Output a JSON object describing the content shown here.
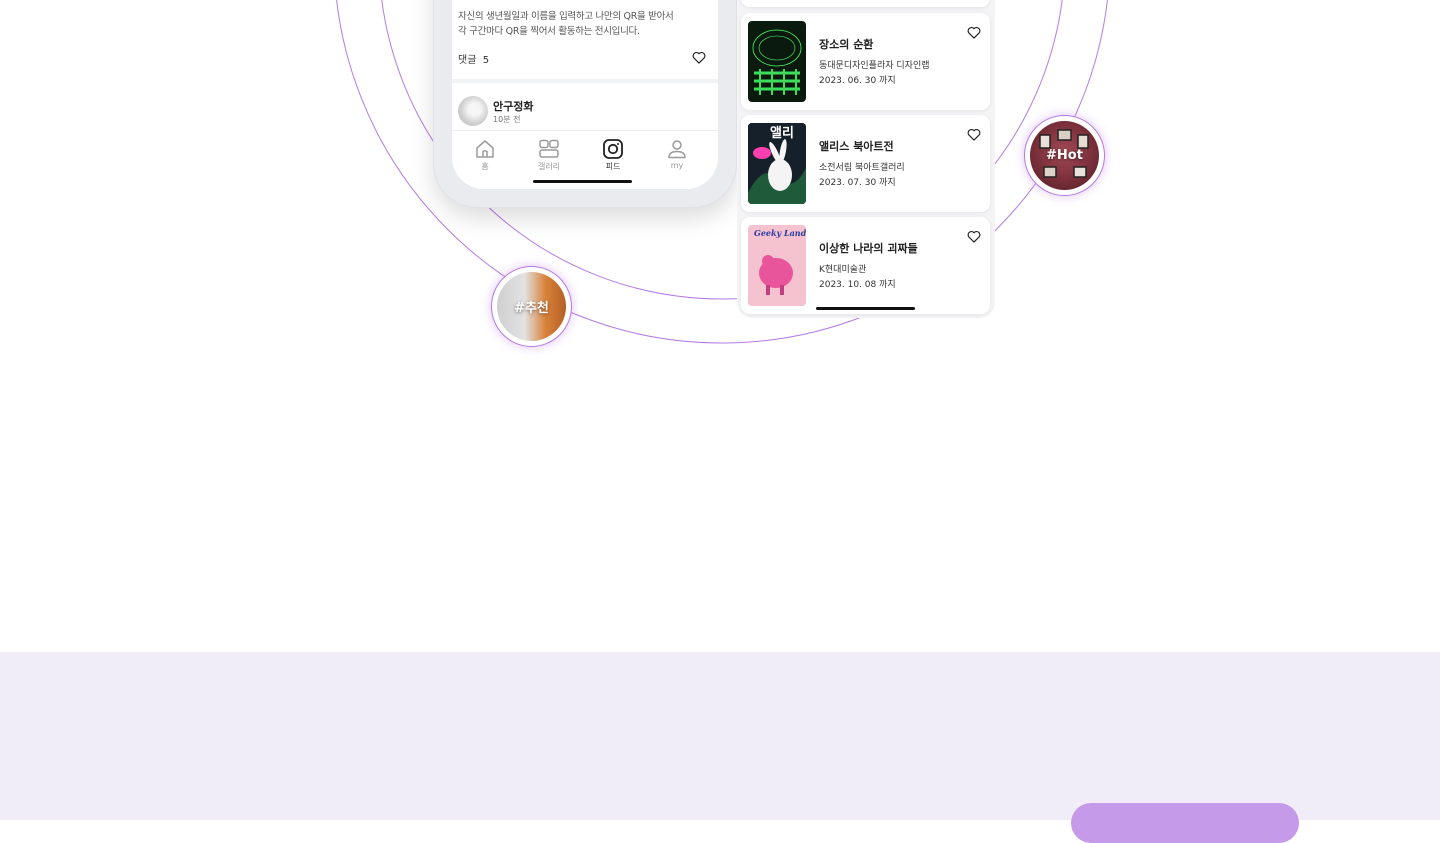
{
  "feed_post": {
    "description_lines": [
      "자신의 생년월일과 이름을 입력하고 나만의 QR을 받아서",
      "각 구간마다 QR을 찍어서 활동하는 전시입니다."
    ],
    "comment_label": "댓글",
    "comment_count": "5"
  },
  "next_post": {
    "author": "안구정화",
    "time": "10분 전"
  },
  "tab_bar": {
    "tabs": [
      {
        "label": "홈",
        "icon": "home-icon"
      },
      {
        "label": "갤러리",
        "icon": "gallery-icon"
      },
      {
        "label": "피드",
        "icon": "feed-icon",
        "active": true
      },
      {
        "label": "my",
        "icon": "profile-icon"
      }
    ]
  },
  "exhibitions": [
    {
      "title": "장소의 순환",
      "venue": "동대문디자인플라자 디자인랩",
      "until": "2023. 06. 30 까지",
      "icon": "heart-icon"
    },
    {
      "title": "앨리스 북아트전",
      "venue": "소전서림 북아트갤러리",
      "until": "2023. 07. 30 까지",
      "icon": "heart-icon"
    },
    {
      "title": "이상한 나라의 괴짜들",
      "venue": "K현대미술관",
      "until": "2023. 10. 08 까지",
      "icon": "heart-icon"
    }
  ],
  "hashtags": {
    "recommend": "#추천",
    "hot": "#Hot"
  },
  "colors": {
    "ring": "#b57be6",
    "lower_section_bg": "#f1edf8",
    "cta": "#c59ae8"
  }
}
